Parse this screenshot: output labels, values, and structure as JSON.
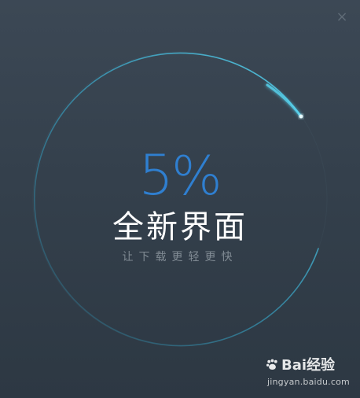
{
  "dialog": {
    "close_glyph": "×",
    "progress_percent": 5,
    "percent_number": "5",
    "percent_sign": "%",
    "title": "全新界面",
    "subtitle": "让下载更轻更快",
    "ring_color": "#49c3e1",
    "number_color": "#2f7fd0"
  },
  "watermark": {
    "brand": "Bai经验",
    "url": "jingyan.baidu.com"
  }
}
